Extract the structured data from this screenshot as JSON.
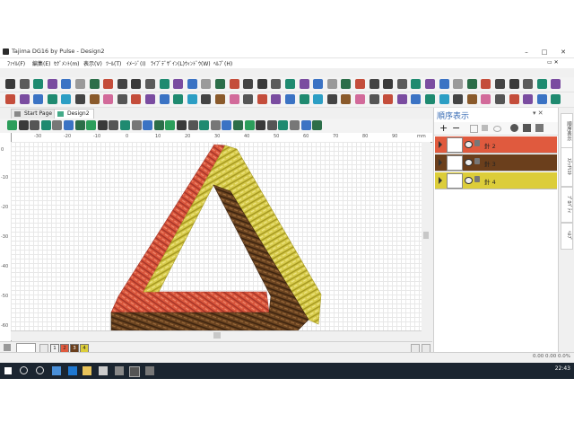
{
  "window": {
    "title": "Tajima DG16 by Pulse - Design2",
    "minimize": "–",
    "maximize": "□",
    "close": "✕"
  },
  "menu": [
    "ﾌｧｲﾙ(F)",
    "編集(E)",
    "ｾｸﾞﾒﾝﾄ(m)",
    "表示(V)",
    "ﾂｰﾙ(T)",
    "ｲﾒｰｼﾞ(I)",
    "ﾗｲﾌﾞﾃﾞｻﾞｲﾝ(L)",
    "ｳｨﾝﾄﾞｳ(W)",
    "ﾍﾙﾌﾟ(H)"
  ],
  "tabs": [
    {
      "label": "Start Page"
    },
    {
      "label": "Design2"
    }
  ],
  "ruler": {
    "unit": "mm",
    "h_ticks": [
      "-30",
      "-20",
      "-10",
      "0",
      "10",
      "20",
      "30",
      "40",
      "50",
      "60",
      "70",
      "80",
      "90",
      "100"
    ],
    "v_ticks": [
      "0",
      "-10",
      "-20",
      "-30",
      "-40",
      "-50",
      "-60"
    ]
  },
  "sequence_panel": {
    "title": "順序表示",
    "rows": [
      {
        "name": "針 2",
        "color": "#e05a3e"
      },
      {
        "name": "針 3",
        "color": "#6b3f1c"
      },
      {
        "name": "針 4",
        "color": "#dccd3a"
      }
    ]
  },
  "vertical_tabs": [
    "順序表示",
    "ｽﾃｯﾁﾘｽﾄ",
    "ﾌﾟﾛﾊﾟﾃｨ",
    "ﾍﾙﾌﾟ"
  ],
  "color_swatches": [
    {
      "num": "1",
      "color": "#f2f2f2"
    },
    {
      "num": "2",
      "color": "#e05a3e"
    },
    {
      "num": "3",
      "color": "#6b3f1c"
    },
    {
      "num": "4",
      "color": "#dccd3a"
    }
  ],
  "status": {
    "coords": "0.00   0.00   0.0%"
  },
  "taskbar": {
    "time": "22:43"
  },
  "design_colors": {
    "red": "#d9553b",
    "brown": "#6a4320",
    "yellow": "#d8cc4c"
  }
}
